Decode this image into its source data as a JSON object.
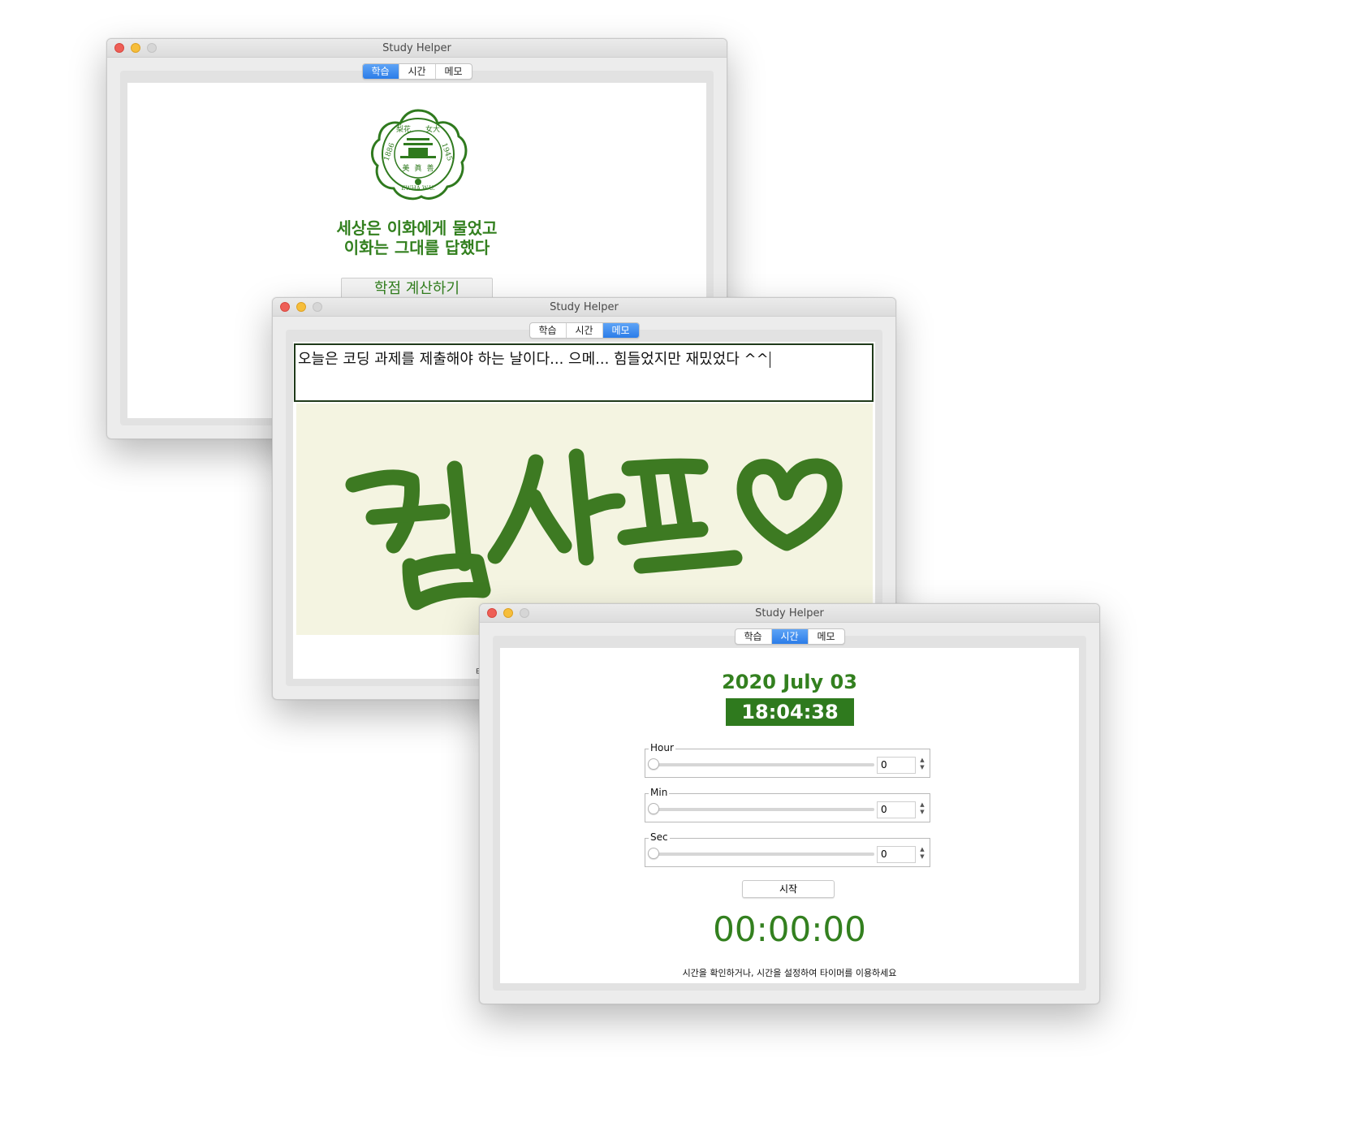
{
  "windows": {
    "learn": {
      "title": "Study Helper",
      "tabs": [
        "학습",
        "시간",
        "메모"
      ],
      "active_tab": "학습",
      "seal_text": {
        "left_year": "1886",
        "right_year": "1945",
        "top_left": "梨花",
        "top_right": "女大",
        "bottom": "EWHA W.U.",
        "center_left": "美",
        "center_mid": "眞",
        "center_right": "善"
      },
      "motto_line1": "세상은 이화에게 물었고",
      "motto_line2": "이화는 그대를 답했다",
      "gpa_button": "학점 계산하기"
    },
    "memo": {
      "title": "Study Helper",
      "tabs": [
        "학습",
        "시간",
        "메모"
      ],
      "active_tab": "메모",
      "memo_text": "오늘은 코딩 과제를 제출해야 하는 날이다... 으메... 힘들었지만 재밌었다 ^^",
      "drawing_text": "컴사프",
      "drawing_color": "#3d7a22",
      "stray_text": "타"
    },
    "time": {
      "title": "Study Helper",
      "tabs": [
        "학습",
        "시간",
        "메모"
      ],
      "active_tab": "시간",
      "date": "2020 July 03",
      "clock": "18:04:38 PM",
      "hour": {
        "label": "Hour",
        "value": "0"
      },
      "min": {
        "label": "Min",
        "value": "0"
      },
      "sec": {
        "label": "Sec",
        "value": "0"
      },
      "start_button": "시작",
      "timer": "00:00:00",
      "hint": "시간을 확인하거나, 시간을 설정하여 타이머를 이용하세요"
    }
  },
  "colors": {
    "accent_green": "#33801f",
    "tab_active": "#2b7ce8"
  }
}
